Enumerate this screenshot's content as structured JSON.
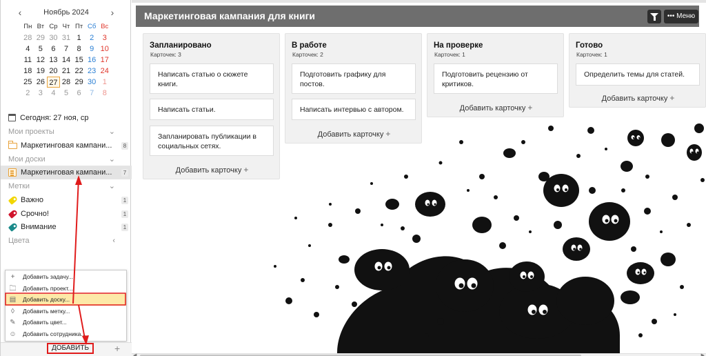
{
  "calendar": {
    "month_label": "Ноябрь 2024",
    "prev_icon": "chevron-left-icon",
    "next_icon": "chevron-right-icon",
    "weekdays": [
      "Пн",
      "Вт",
      "Ср",
      "Чт",
      "Пт",
      "Сб",
      "Вс"
    ],
    "weeks": [
      [
        "28",
        "29",
        "30",
        "31",
        "1",
        "2",
        "3"
      ],
      [
        "4",
        "5",
        "6",
        "7",
        "8",
        "9",
        "10"
      ],
      [
        "11",
        "12",
        "13",
        "14",
        "15",
        "16",
        "17"
      ],
      [
        "18",
        "19",
        "20",
        "21",
        "22",
        "23",
        "24"
      ],
      [
        "25",
        "26",
        "27",
        "28",
        "29",
        "30",
        "1"
      ],
      [
        "2",
        "3",
        "4",
        "5",
        "6",
        "7",
        "8"
      ]
    ],
    "today_value": "27",
    "colors": {
      "saturday": "#2a7fd4",
      "sunday": "#e0362b",
      "today_border": "#e8a23a"
    }
  },
  "sidebar": {
    "today_label": "Сегодня: 27 ноя, ср",
    "projects_header": "Мои проекты",
    "project_item": {
      "label": "Маркетинговая кампани...",
      "count": "8"
    },
    "boards_header": "Мои доски",
    "board_item": {
      "label": "Маркетинговая кампани...",
      "count": "7"
    },
    "tags_header": "Метки",
    "tags": [
      {
        "label": "Важно",
        "count": "1",
        "color": "#f2d600"
      },
      {
        "label": "Срочно!",
        "count": "1",
        "color": "#d0142c"
      },
      {
        "label": "Внимание",
        "count": "1",
        "color": "#1a8a8a"
      }
    ],
    "colors_header": "Цвета",
    "add_button": "ДОБАВИТЬ",
    "add_plus": "+"
  },
  "add_menu": {
    "items": [
      {
        "label": "Добавить задачу...",
        "icon": "plus-icon"
      },
      {
        "label": "Добавить проект...",
        "icon": "folder-icon"
      },
      {
        "label": "Добавить доску...",
        "icon": "board-icon"
      },
      {
        "label": "Добавить метку...",
        "icon": "tag-icon"
      },
      {
        "label": "Добавить цвет...",
        "icon": "brush-icon"
      },
      {
        "label": "Добавить сотрудника...",
        "icon": "user-icon"
      }
    ],
    "active_index": 2,
    "active_color": "#fde9a8"
  },
  "board": {
    "title": "Маркетинговая кампания для книги",
    "menu_label": "••• Меню",
    "header_color": "#6e6e6e",
    "columns": [
      {
        "title": "Запланировано",
        "count_label": "Карточек: 3",
        "cards": [
          "Написать статью о сюжете книги.",
          "Написать статьи.",
          "Запланировать публикации в социальных сетях."
        ],
        "add_label": "Добавить карточку"
      },
      {
        "title": "В работе",
        "count_label": "Карточек: 2",
        "cards": [
          "Подготовить графику для постов.",
          "Написать интервью с автором."
        ],
        "add_label": "Добавить карточку"
      },
      {
        "title": "На проверке",
        "count_label": "Карточек: 1",
        "cards": [
          "Подготовить рецензию от критиков."
        ],
        "add_label": "Добавить карточку"
      },
      {
        "title": "Готово",
        "count_label": "Карточек: 1",
        "cards": [
          "Определить темы для статей."
        ],
        "add_label": "Добавить карточку"
      }
    ]
  },
  "annotation_color": "#e01b1b"
}
